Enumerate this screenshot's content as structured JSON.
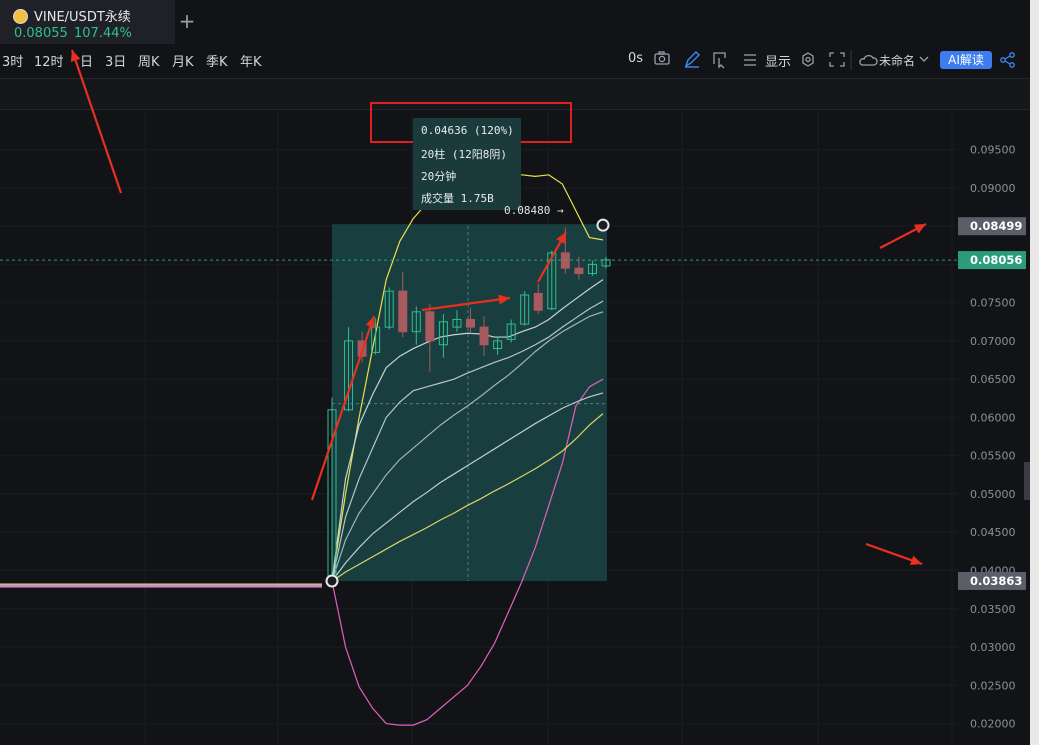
{
  "tab": {
    "title": "VINE/USDT永续",
    "price": "0.08055",
    "change": "107.44%",
    "add_symbol": "+"
  },
  "toolbar": {
    "timeframes": [
      "3时",
      "12时",
      "日",
      "3日",
      "周K",
      "月K",
      "季K",
      "年K"
    ],
    "countdown": "0s",
    "display_label": "显示",
    "layout_name": "未命名",
    "ai_label": "AI解读",
    "icons": [
      "camera-icon",
      "pencil-icon",
      "select-icon",
      "list-icon",
      "gear-icon",
      "fullscreen-icon",
      "cloud-icon",
      "chevron-down-icon",
      "share-icon"
    ]
  },
  "measure_tooltip": {
    "change": "0.04636 (120%)",
    "bars": "20柱 (12阳8阴)",
    "duration": "20分钟",
    "volume": "成交量 1.75B"
  },
  "chart_annotations": {
    "high_marker": "0.08480 →"
  },
  "colors": {
    "background": "#121316",
    "up": "#2fbf8f",
    "down": "#a85a5e",
    "highlight_box": "#e02020",
    "arrow": "#e83020",
    "measure_area": "#1b4a4c",
    "upper_band": "#e8e04a",
    "lower_band": "#e060c0"
  },
  "chart_data": {
    "type": "candlestick",
    "y_axis_ticks": [
      "0.09500",
      "0.09000",
      "0.08500",
      "0.08000",
      "0.07500",
      "0.07000",
      "0.06500",
      "0.06000",
      "0.05500",
      "0.05000",
      "0.04500",
      "0.04000",
      "0.03500",
      "0.03000",
      "0.02500",
      "0.02000"
    ],
    "ylim": [
      0.0172,
      0.1003
    ],
    "price_labels": [
      {
        "value": 0.08499,
        "text": "0.08499",
        "kind": "high"
      },
      {
        "value": 0.08056,
        "text": "0.08056",
        "kind": "current"
      },
      {
        "value": 0.03863,
        "text": "0.03863",
        "kind": "low"
      }
    ],
    "candles": [
      {
        "o": 0.0386,
        "h": 0.0626,
        "l": 0.0386,
        "c": 0.061
      },
      {
        "o": 0.061,
        "h": 0.0718,
        "l": 0.0608,
        "c": 0.07
      },
      {
        "o": 0.07,
        "h": 0.0712,
        "l": 0.0672,
        "c": 0.068
      },
      {
        "o": 0.0685,
        "h": 0.073,
        "l": 0.0682,
        "c": 0.0718
      },
      {
        "o": 0.0718,
        "h": 0.077,
        "l": 0.0715,
        "c": 0.0765
      },
      {
        "o": 0.0765,
        "h": 0.079,
        "l": 0.0705,
        "c": 0.0712
      },
      {
        "o": 0.0712,
        "h": 0.0745,
        "l": 0.0695,
        "c": 0.0738
      },
      {
        "o": 0.0738,
        "h": 0.0748,
        "l": 0.066,
        "c": 0.07
      },
      {
        "o": 0.0695,
        "h": 0.0735,
        "l": 0.0678,
        "c": 0.0725
      },
      {
        "o": 0.0718,
        "h": 0.074,
        "l": 0.0712,
        "c": 0.0728
      },
      {
        "o": 0.0728,
        "h": 0.0743,
        "l": 0.071,
        "c": 0.0718
      },
      {
        "o": 0.0718,
        "h": 0.0732,
        "l": 0.068,
        "c": 0.0695
      },
      {
        "o": 0.069,
        "h": 0.0705,
        "l": 0.0682,
        "c": 0.07
      },
      {
        "o": 0.0702,
        "h": 0.0728,
        "l": 0.0698,
        "c": 0.0722
      },
      {
        "o": 0.0722,
        "h": 0.0765,
        "l": 0.072,
        "c": 0.076
      },
      {
        "o": 0.0762,
        "h": 0.0775,
        "l": 0.0735,
        "c": 0.074
      },
      {
        "o": 0.0742,
        "h": 0.0818,
        "l": 0.074,
        "c": 0.0815
      },
      {
        "o": 0.0815,
        "h": 0.0848,
        "l": 0.0788,
        "c": 0.0795
      },
      {
        "o": 0.0795,
        "h": 0.081,
        "l": 0.078,
        "c": 0.0788
      },
      {
        "o": 0.0788,
        "h": 0.0805,
        "l": 0.0785,
        "c": 0.08
      },
      {
        "o": 0.0798,
        "h": 0.081,
        "l": 0.0795,
        "c": 0.0806
      }
    ],
    "upper_band": [
      0.0386,
      0.05,
      0.06,
      0.069,
      0.078,
      0.083,
      0.086,
      0.088,
      0.0895,
      0.0905,
      0.0912,
      0.0916,
      0.0918,
      0.0918,
      0.0917,
      0.0915,
      0.0917,
      0.0905,
      0.087,
      0.0835,
      0.0832
    ],
    "lower_band": [
      0.0386,
      0.03,
      0.0248,
      0.022,
      0.02,
      0.0198,
      0.0198,
      0.0205,
      0.022,
      0.0235,
      0.025,
      0.0275,
      0.0305,
      0.0345,
      0.0385,
      0.043,
      0.0485,
      0.054,
      0.0615,
      0.064,
      0.065
    ],
    "ma_lines": [
      [
        0.0386,
        0.052,
        0.059,
        0.063,
        0.0665,
        0.068,
        0.069,
        0.0698,
        0.0705,
        0.0708,
        0.071,
        0.0709,
        0.0705,
        0.0705,
        0.0712,
        0.0718,
        0.0728,
        0.0742,
        0.0755,
        0.0768,
        0.078
      ],
      [
        0.0386,
        0.047,
        0.052,
        0.056,
        0.06,
        0.062,
        0.0635,
        0.064,
        0.0645,
        0.065,
        0.0658,
        0.0665,
        0.0672,
        0.0678,
        0.0686,
        0.0695,
        0.0705,
        0.0718,
        0.073,
        0.0742,
        0.0752
      ],
      [
        0.0386,
        0.044,
        0.0475,
        0.05,
        0.0525,
        0.0545,
        0.056,
        0.0575,
        0.059,
        0.0603,
        0.0615,
        0.0628,
        0.0642,
        0.0655,
        0.067,
        0.0686,
        0.07,
        0.0712,
        0.0722,
        0.0732,
        0.0738
      ],
      [
        0.0386,
        0.041,
        0.043,
        0.0448,
        0.0462,
        0.0476,
        0.049,
        0.0502,
        0.0515,
        0.0526,
        0.0537,
        0.0548,
        0.0559,
        0.057,
        0.0581,
        0.0592,
        0.0602,
        0.0612,
        0.062,
        0.0627,
        0.0632
      ],
      [
        0.0386,
        0.0398,
        0.0408,
        0.0418,
        0.0428,
        0.0438,
        0.0447,
        0.0456,
        0.0466,
        0.0475,
        0.0485,
        0.0494,
        0.0504,
        0.0513,
        0.0523,
        0.0533,
        0.0544,
        0.0556,
        0.0572,
        0.059,
        0.0605
      ]
    ],
    "flat_segment_value": 0.0381
  }
}
